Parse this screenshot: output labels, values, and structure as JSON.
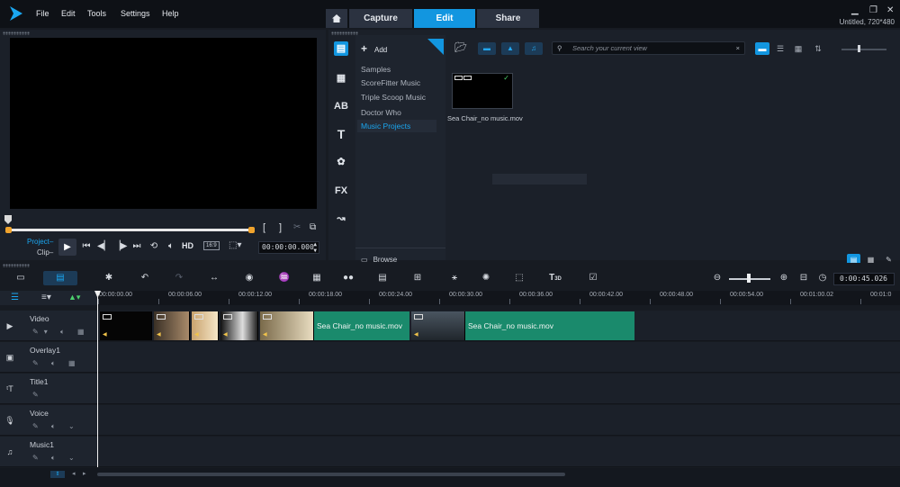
{
  "menu": {
    "file": "File",
    "edit": "Edit",
    "tools": "Tools",
    "settings": "Settings",
    "help": "Help"
  },
  "tabs": {
    "capture": "Capture",
    "edit": "Edit",
    "share": "Share"
  },
  "project_info": "Untitled, 720*480",
  "player": {
    "mode_project": "Project",
    "mode_clip": "Clip",
    "hd_label": "HD",
    "aspect": "16:9",
    "timecode": "00:00:00.000",
    "brackets_in": "[",
    "brackets_out": "]"
  },
  "library": {
    "add_label": "Add",
    "folders": [
      "Samples",
      "ScoreFitter Music",
      "Triple Scoop Music",
      "Doctor Who",
      "Music Projects"
    ],
    "selected_folder": "Music Projects",
    "browse_label": "Browse",
    "search_placeholder": "Search your current view",
    "media_items": [
      {
        "label": "Sea Chair_no music.mov"
      }
    ]
  },
  "timeline": {
    "timecode": "0:00:45.026",
    "ruler_ticks": [
      "00:00:00.00",
      "00:00:06.00",
      "00:00:12.00",
      "00:00:18.00",
      "00:00:24.00",
      "00:00:30.00",
      "00:00:36.00",
      "00:00:42.00",
      "00:00:48.00",
      "00:00:54.00",
      "00:01:00.02",
      "00:01:0"
    ],
    "tracks": [
      {
        "name": "Video",
        "icon": "video-track-icon"
      },
      {
        "name": "Overlay1",
        "icon": "overlay-track-icon"
      },
      {
        "name": "Title1",
        "icon": "title-track-icon"
      },
      {
        "name": "Voice",
        "icon": "voice-track-icon"
      },
      {
        "name": "Music1",
        "icon": "music-track-icon"
      }
    ],
    "clips": [
      {
        "label": "Sea Chair_no music.mov"
      },
      {
        "label": "Sea Chair_no music.mov"
      }
    ]
  },
  "colors": {
    "accent": "#1296e0",
    "clip_green": "#1a8a6c",
    "marker_orange": "#f0a32d"
  }
}
